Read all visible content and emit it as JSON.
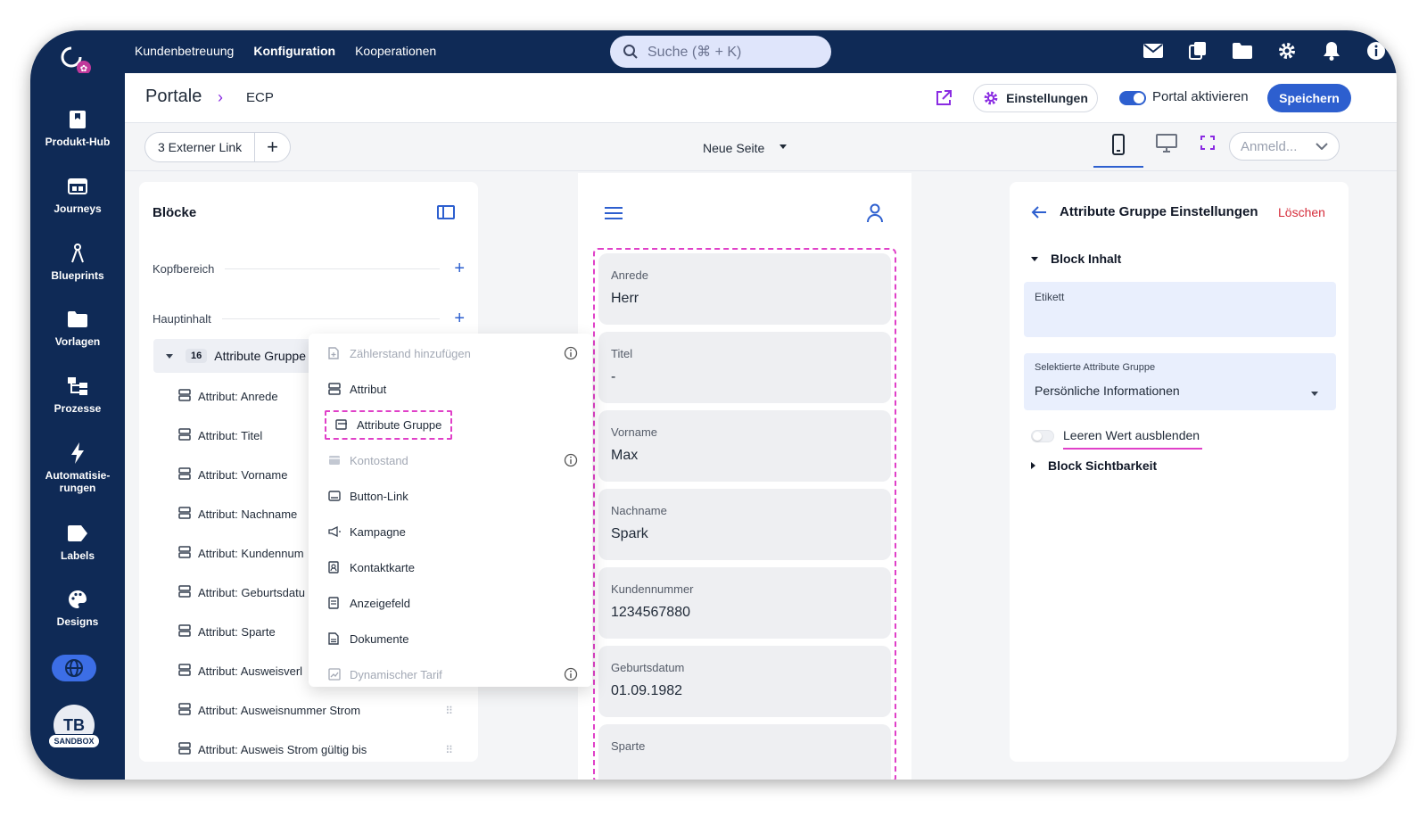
{
  "topnav": {
    "items": [
      "Kundenbetreuung",
      "Konfiguration",
      "Kooperationen"
    ],
    "active": "Konfiguration"
  },
  "search": {
    "placeholder": "Suche (⌘ + K)"
  },
  "topicons": [
    "mail-icon",
    "copy-icon",
    "folder-icon",
    "gear-icon",
    "bell-icon",
    "info-icon"
  ],
  "sidebar": {
    "items": [
      {
        "label": "Produkt-Hub",
        "icon": "bookmark-icon"
      },
      {
        "label": "Journeys",
        "icon": "window-icon"
      },
      {
        "label": "Blueprints",
        "icon": "compass-icon"
      },
      {
        "label": "Vorlagen",
        "icon": "folder-icon"
      },
      {
        "label": "Prozesse",
        "icon": "flow-icon"
      },
      {
        "label": "Automatisie-\nrungen",
        "icon": "bolt-icon"
      },
      {
        "label": "Labels",
        "icon": "label-icon"
      },
      {
        "label": "Designs",
        "icon": "palette-icon"
      }
    ],
    "avatar": "TB",
    "sandbox": "SANDBOX"
  },
  "header": {
    "crumb_main": "Portale",
    "crumb_sep": "›",
    "crumb_sub": "ECP",
    "settings_label": "Einstellungen",
    "portal_toggle_label": "Portal aktivieren",
    "portal_active": true,
    "save_label": "Speichern"
  },
  "toolbar": {
    "link_label": "3 Externer Link",
    "add_label": "+",
    "page_label": "Neue Seite",
    "login_select": "Anmeld..."
  },
  "blocks": {
    "title": "Blöcke",
    "sections": [
      "Kopfbereich",
      "Hauptinhalt"
    ],
    "group": {
      "badge": "16",
      "name": "Attribute Gruppe"
    },
    "attributes": [
      "Attribut: Anrede",
      "Attribut: Titel",
      "Attribut: Vorname",
      "Attribut: Nachname",
      "Attribut: Kundennum",
      "Attribut: Geburtsdatu",
      "Attribut: Sparte",
      "Attribut: Ausweisverl",
      "Attribut: Ausweisnummer Strom",
      "Attribut: Ausweis Strom gültig bis"
    ]
  },
  "menu": {
    "items": [
      {
        "label": "Zählerstand hinzufügen",
        "disabled": true,
        "info": true
      },
      {
        "label": "Attribut",
        "disabled": false
      },
      {
        "label": "Attribute Gruppe",
        "disabled": false,
        "highlight": true
      },
      {
        "label": "Kontostand",
        "disabled": true,
        "info": true
      },
      {
        "label": "Button-Link",
        "disabled": false
      },
      {
        "label": "Kampagne",
        "disabled": false
      },
      {
        "label": "Kontaktkarte",
        "disabled": false
      },
      {
        "label": "Anzeigefeld",
        "disabled": false
      },
      {
        "label": "Dokumente",
        "disabled": false
      },
      {
        "label": "Dynamischer Tarif",
        "disabled": true,
        "info": true
      }
    ]
  },
  "preview": {
    "fields": [
      {
        "label": "Anrede",
        "value": "Herr"
      },
      {
        "label": "Titel",
        "value": "-"
      },
      {
        "label": "Vorname",
        "value": "Max"
      },
      {
        "label": "Nachname",
        "value": "Spark"
      },
      {
        "label": "Kundennummer",
        "value": "1234567880"
      },
      {
        "label": "Geburtsdatum",
        "value": "01.09.1982"
      },
      {
        "label": "Sparte",
        "value": ""
      }
    ]
  },
  "settings": {
    "title": "Attribute Gruppe Einstellungen",
    "delete_label": "Löschen",
    "section_content": "Block Inhalt",
    "etikett_label": "Etikett",
    "select_label": "Selektierte Attribute Gruppe",
    "select_value": "Persönliche Informationen",
    "hide_empty_label": "Leeren Wert ausblenden",
    "section_visibility": "Block Sichtbarkeit"
  },
  "colors": {
    "navy": "#0f2a56",
    "primary": "#2d5fcf",
    "highlight": "#e040c8",
    "danger": "#d62d3b"
  }
}
